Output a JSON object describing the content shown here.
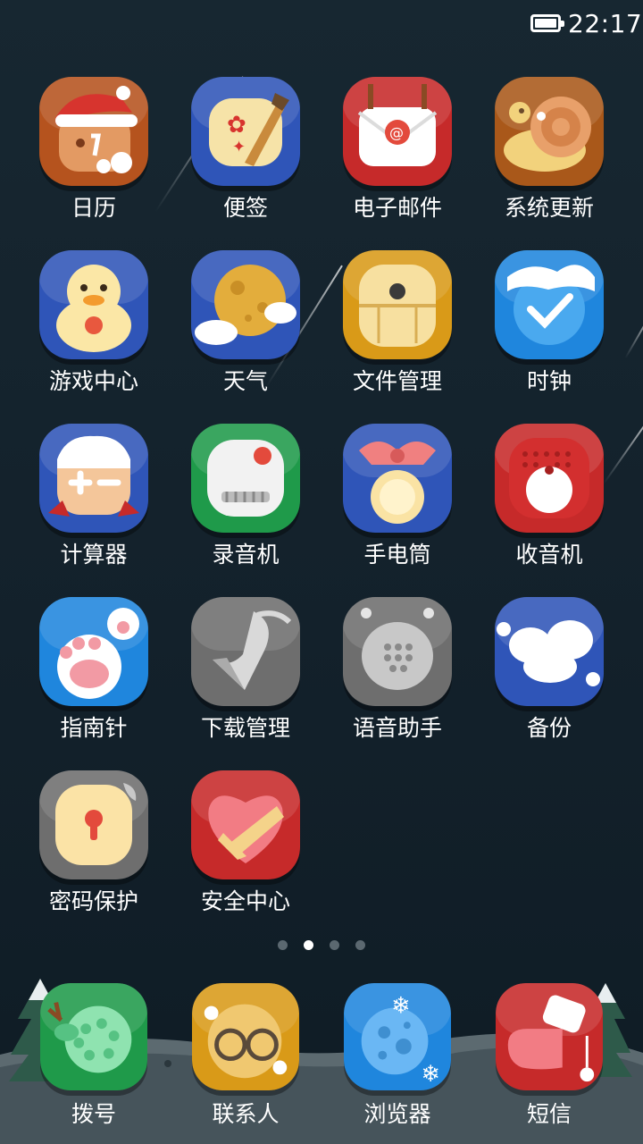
{
  "status_bar": {
    "time": "22:17",
    "battery_icon": "battery-full-icon"
  },
  "apps": [
    {
      "label": "日历",
      "icon": "calendar-gingerbread-icon",
      "color": "#b5531e"
    },
    {
      "label": "便签",
      "icon": "notes-paper-brush-icon",
      "color": "#2f55b8"
    },
    {
      "label": "电子邮件",
      "icon": "email-envelope-icon",
      "color": "#c62a2a"
    },
    {
      "label": "系统更新",
      "icon": "system-update-snail-icon",
      "color": "#a9581a"
    },
    {
      "label": "游戏中心",
      "icon": "game-center-duck-icon",
      "color": "#2f55b8"
    },
    {
      "label": "天气",
      "icon": "weather-moon-cloud-icon",
      "color": "#2f55b8"
    },
    {
      "label": "文件管理",
      "icon": "file-manager-drawer-icon",
      "color": "#d99a18"
    },
    {
      "label": "时钟",
      "icon": "clock-snow-icon",
      "color": "#1f86dd"
    },
    {
      "label": "计算器",
      "icon": "calculator-icon",
      "color": "#2f55b8"
    },
    {
      "label": "录音机",
      "icon": "recorder-icon",
      "color": "#1f9a4a"
    },
    {
      "label": "手电筒",
      "icon": "flashlight-bell-icon",
      "color": "#2f55b8"
    },
    {
      "label": "收音机",
      "icon": "radio-icon",
      "color": "#c62a2a"
    },
    {
      "label": "指南针",
      "icon": "compass-paw-icon",
      "color": "#1f86dd"
    },
    {
      "label": "下载管理",
      "icon": "download-manager-icon",
      "color": "#6e6e6e"
    },
    {
      "label": "语音助手",
      "icon": "voice-assistant-icon",
      "color": "#6e6e6e"
    },
    {
      "label": "备份",
      "icon": "backup-cloud-icon",
      "color": "#2f55b8"
    },
    {
      "label": "密码保护",
      "icon": "password-lock-icon",
      "color": "#6e6e6e"
    },
    {
      "label": "安全中心",
      "icon": "security-heart-icon",
      "color": "#c62a2a"
    }
  ],
  "page_indicator": {
    "count": 4,
    "active_index": 1
  },
  "dock": [
    {
      "label": "拨号",
      "icon": "dialer-reindeer-icon",
      "color": "#1f9a4a"
    },
    {
      "label": "联系人",
      "icon": "contacts-bear-icon",
      "color": "#d99a18"
    },
    {
      "label": "浏览器",
      "icon": "browser-globe-icon",
      "color": "#1f86dd"
    },
    {
      "label": "短信",
      "icon": "messages-stocking-icon",
      "color": "#c62a2a"
    }
  ]
}
